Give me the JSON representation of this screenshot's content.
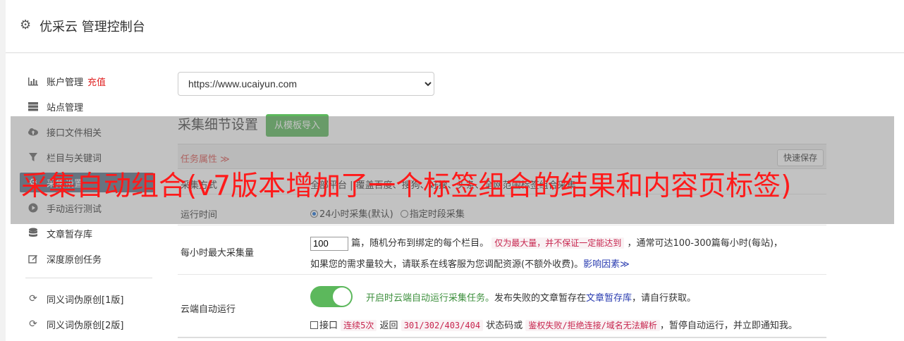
{
  "header": {
    "title": "优采云 管理控制台",
    "icon": "gear-icon"
  },
  "sidebar": {
    "items": [
      {
        "label": "账户管理",
        "badge": "充值",
        "icon": "bar-chart-icon"
      },
      {
        "label": "站点管理",
        "icon": "server-icon"
      },
      {
        "label": "接口文件相关",
        "icon": "cloud-upload-icon"
      },
      {
        "label": "栏目与关键词",
        "icon": "filter-icon"
      },
      {
        "label": "采集设置",
        "icon": "gears-icon",
        "active": true
      },
      {
        "label": "手动运行测试",
        "icon": "play-icon"
      },
      {
        "label": "文章暂存库",
        "icon": "database-icon"
      },
      {
        "label": "深度原创任务",
        "icon": "edit-icon"
      },
      {
        "label": "同义词伪原创[1版]",
        "icon": "refresh-icon"
      },
      {
        "label": "同义词伪原创[2版]",
        "icon": "refresh-icon"
      }
    ]
  },
  "site_select": {
    "value": "https://www.ucaiyun.com"
  },
  "section": {
    "title": "采集细节设置",
    "import_label": "从模板导入"
  },
  "attr_bar": {
    "label": "任务属性 ≫",
    "save_label": "快速保存"
  },
  "rows": {
    "collect_mode": {
      "label": "采集方式",
      "value": "全部平台 | 覆盖百度、搜狗、好搜、头条、全网范围标签组合采集"
    },
    "run_time": {
      "label": "运行时间",
      "option1": "24小时采集(默认)",
      "option2": "指定时段采集"
    },
    "max_per_hour": {
      "label": "每小时最大采集量",
      "input_value": "100",
      "text1": "篇，随机分布到绑定的每个栏目。",
      "code1": "仅为最大量，并不保证一定能达到",
      "text2": "，通常可达100-300篇每小时(每站)，",
      "text3": "如果您的需求量较大，请联系在线客服为您调配资源(不额外收费)。",
      "link": "影响因素≫"
    },
    "cloud_run": {
      "label": "云端自动运行",
      "toggle_text": "开启时云端自动运行采集任务。",
      "desc1": "发布失败的文章暂存在",
      "link": "文章暂存库",
      "desc2": "，请自行获取。",
      "check_label": "接口",
      "code1": "连续5次",
      "t1": "返回",
      "code2": "301/302/403/404",
      "t2": "状态码或",
      "code3": "鉴权失败/拒绝连接/域名无法解析",
      "t3": "，暂停自动运行，并立即通知我。"
    }
  },
  "overlay": {
    "caption": "采集自动组合(v7版本增加了一个标签组合的结果和内容页标签)"
  }
}
